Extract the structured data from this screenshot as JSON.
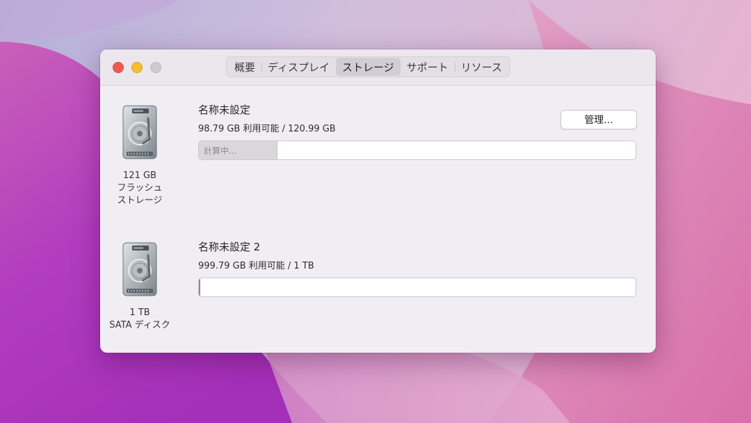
{
  "window": {
    "tabs": [
      {
        "label": "概要",
        "active": false
      },
      {
        "label": "ディスプレイ",
        "active": false
      },
      {
        "label": "ストレージ",
        "active": true
      },
      {
        "label": "サポート",
        "active": false
      },
      {
        "label": "リソース",
        "active": false
      }
    ]
  },
  "drives": [
    {
      "icon": "hard-drive-icon",
      "capacity": "121 GB",
      "type_line1": "フラッシュ",
      "type_line2": "ストレージ",
      "volume_name": "名称未設定",
      "volume_info": "98.79 GB 利用可能 / 120.99 GB",
      "usage_label": "計算中...",
      "usage_fraction": 0.18,
      "manage_label": "管理..."
    },
    {
      "icon": "hard-drive-icon",
      "capacity": "1 TB",
      "type_line1": "SATA ディスク",
      "volume_name": "名称未設定 2",
      "volume_info": "999.79 GB 利用可能 / 1 TB",
      "usage_fraction": 0.0
    }
  ],
  "colors": {
    "window_bg": "#f1eef3",
    "close": "#ee5a52",
    "minimize": "#f5bd2f",
    "zoom": "#cdc9ce",
    "wallpaper_accent": "#c257c4"
  }
}
